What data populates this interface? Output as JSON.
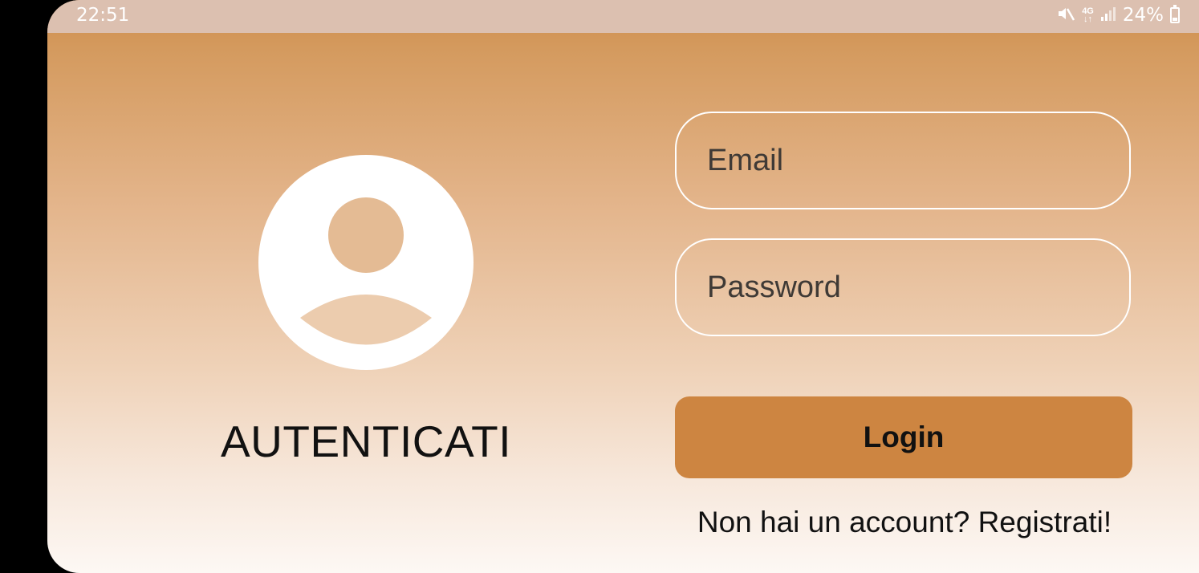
{
  "status_bar": {
    "time": "22:51",
    "network_type": "4G",
    "battery_percent": "24%",
    "icons": [
      "mute-icon",
      "4g-icon",
      "signal-icon",
      "battery-icon"
    ]
  },
  "login": {
    "title": "AUTENTICATI",
    "email_placeholder": "Email",
    "password_placeholder": "Password",
    "login_label": "Login",
    "register_prompt": "Non hai un account?",
    "register_link": "Registrati!"
  },
  "colors": {
    "accent": "#cd8541",
    "gradient_top": "#cf8c4a",
    "gradient_bottom": "#fdf8f4",
    "status_bar": "#dcc0b0"
  }
}
